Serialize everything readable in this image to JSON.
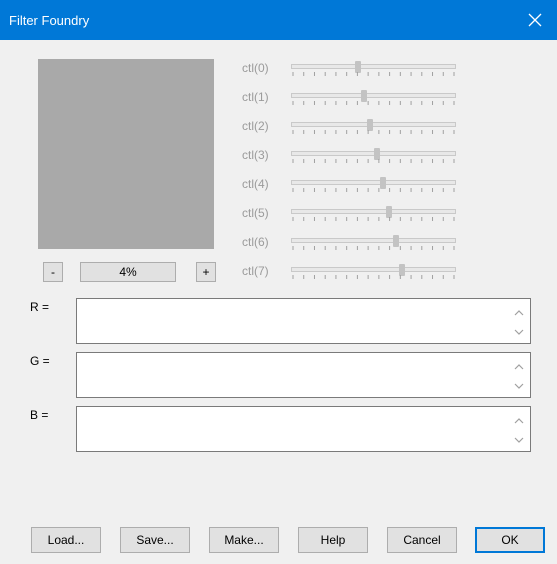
{
  "window": {
    "title": "Filter Foundry",
    "close_icon": "close-icon"
  },
  "zoom": {
    "minus_label": "-",
    "value": "4%",
    "plus_label": "+"
  },
  "controls": [
    {
      "label": "ctl(0)",
      "value": 0.4
    },
    {
      "label": "ctl(1)",
      "value": 0.44
    },
    {
      "label": "ctl(2)",
      "value": 0.48
    },
    {
      "label": "ctl(3)",
      "value": 0.52
    },
    {
      "label": "ctl(4)",
      "value": 0.56
    },
    {
      "label": "ctl(5)",
      "value": 0.6
    },
    {
      "label": "ctl(6)",
      "value": 0.64
    },
    {
      "label": "ctl(7)",
      "value": 0.68
    }
  ],
  "formulas": [
    {
      "label": "R =",
      "value": ""
    },
    {
      "label": "G =",
      "value": ""
    },
    {
      "label": "B =",
      "value": ""
    }
  ],
  "buttons": {
    "load": "Load...",
    "save": "Save...",
    "make": "Make...",
    "help": "Help",
    "cancel": "Cancel",
    "ok": "OK"
  },
  "colors": {
    "title_bar": "#0078d7",
    "preview": "#a9a9a9",
    "background": "#f0f0f0"
  }
}
